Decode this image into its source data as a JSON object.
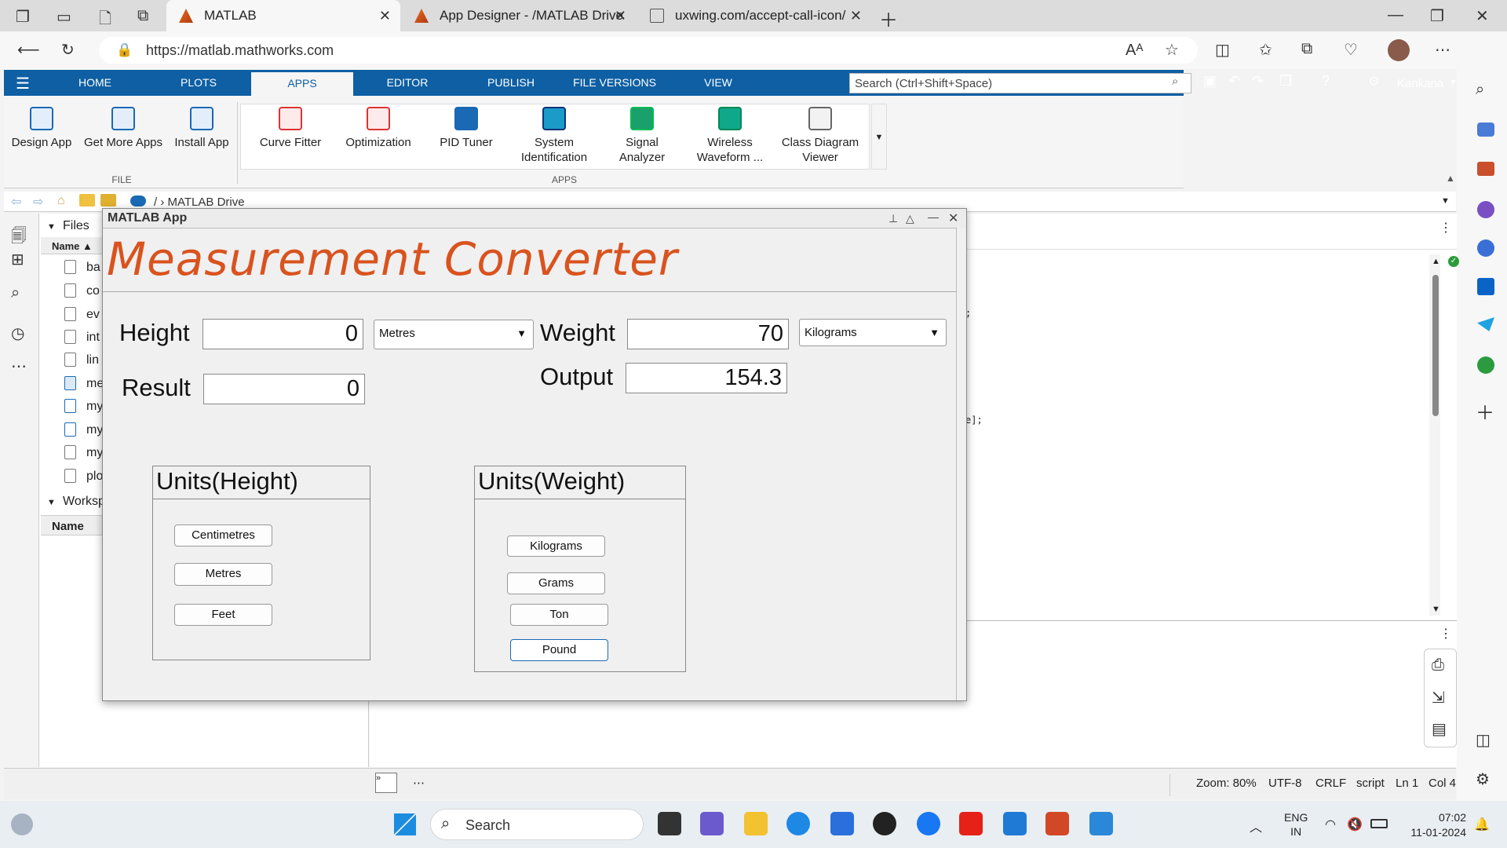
{
  "browser": {
    "tabs": [
      {
        "label": "MATLAB",
        "close": "✕"
      },
      {
        "label": "App Designer - /MATLAB Drive/n",
        "close": "✕"
      },
      {
        "label": "uxwing.com/accept-call-icon/",
        "close": "✕"
      }
    ],
    "url": "https://matlab.mathworks.com"
  },
  "matlab": {
    "tabs": [
      "HOME",
      "PLOTS",
      "APPS",
      "EDITOR",
      "PUBLISH",
      "FILE VERSIONS",
      "VIEW"
    ],
    "search_placeholder": "Search (Ctrl+Shift+Space)",
    "user": "Kankana",
    "file_tools": [
      "Design App",
      "Get More Apps",
      "Install App"
    ],
    "file_section": "FILE",
    "apps_tools": [
      [
        "Curve Fitter",
        ""
      ],
      [
        "Optimization",
        ""
      ],
      [
        "PID Tuner",
        ""
      ],
      [
        "System",
        "Identification"
      ],
      [
        "Signal",
        "Analyzer"
      ],
      [
        "Wireless",
        "Waveform ..."
      ],
      [
        "Class Diagram",
        "Viewer"
      ]
    ],
    "apps_section": "APPS",
    "path": "/ › MATLAB Drive",
    "files_label": "Files",
    "name_header": "Name ▲",
    "file_items": [
      "ba",
      "co",
      "ev",
      "int",
      "lin",
      "me",
      "my",
      "my",
      "my",
      "plo"
    ],
    "workspace_label": "Worksp",
    "workspace_name": "Name",
    "code_fragments": [
      ";",
      "e];"
    ],
    "status": {
      "zoom": "Zoom: 80%",
      "encoding": "UTF-8",
      "eol": "CRLF",
      "type": "script",
      "ln": "Ln 1",
      "col": "Col 4"
    }
  },
  "app": {
    "window_title": "MATLAB App",
    "header": "Measurement Converter",
    "height_label": "Height",
    "height_value": "0",
    "height_unit": "Metres",
    "weight_label": "Weight",
    "weight_value": "70",
    "weight_unit": "Kilograms",
    "result_label": "Result",
    "result_value": "0",
    "output_label": "Output",
    "output_value": "154.3",
    "height_panel": {
      "title": "Units(Height)",
      "buttons": [
        "Centimetres",
        "Metres",
        "Feet"
      ]
    },
    "weight_panel": {
      "title": "Units(Weight)",
      "buttons": [
        "Kilograms",
        "Grams",
        "Ton",
        "Pound"
      ]
    }
  },
  "taskbar": {
    "search": "Search",
    "lang1": "ENG",
    "lang2": "IN",
    "time": "07:02",
    "date": "11-01-2024"
  },
  "colors": {
    "matlab_blue": "#0e5fa3",
    "header_orange": "#d9531e"
  }
}
